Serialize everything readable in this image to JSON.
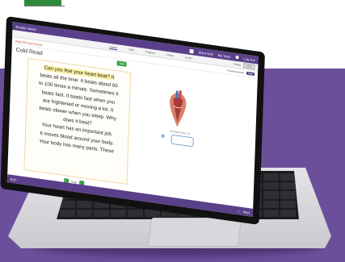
{
  "app": {
    "brand": "Reader Island",
    "top_links": [
      "Word Wall",
      "My Tools",
      "Log Out"
    ],
    "nav_tabs": [
      "Lesson",
      "Skills",
      "Progress",
      "Library",
      "Bonus"
    ],
    "score_label": "Points",
    "score_value": "00000",
    "lesson_title": "Kids Of Your Heart",
    "speed_label": "Reading Speed",
    "speed_value": "Fast"
  },
  "content": {
    "section_title": "Cold Read",
    "start_button": "Start",
    "passage_highlight": "Can you feel your heart beat? It",
    "passage_lines": [
      "beats all the time. It beats about 60",
      "to 100 times a minute. Sometimes it",
      "beats fast. It beats fast when you",
      "are frightened or moving a lot. It",
      "beats slower when you sleep. Why",
      "does it beat?",
      "Your heart has an important job.",
      "It moves blood around your body.",
      "Your body has many parts. These"
    ],
    "page_label": "Page",
    "caption_label": "Cold Read Cards 1-20"
  },
  "footer": {
    "left": "ELP",
    "right": "Next"
  },
  "colors": {
    "purple": "#6c4f9a",
    "app_purple": "#5a3f8a",
    "green": "#3aa34a",
    "highlight": "#fdf2a4"
  }
}
